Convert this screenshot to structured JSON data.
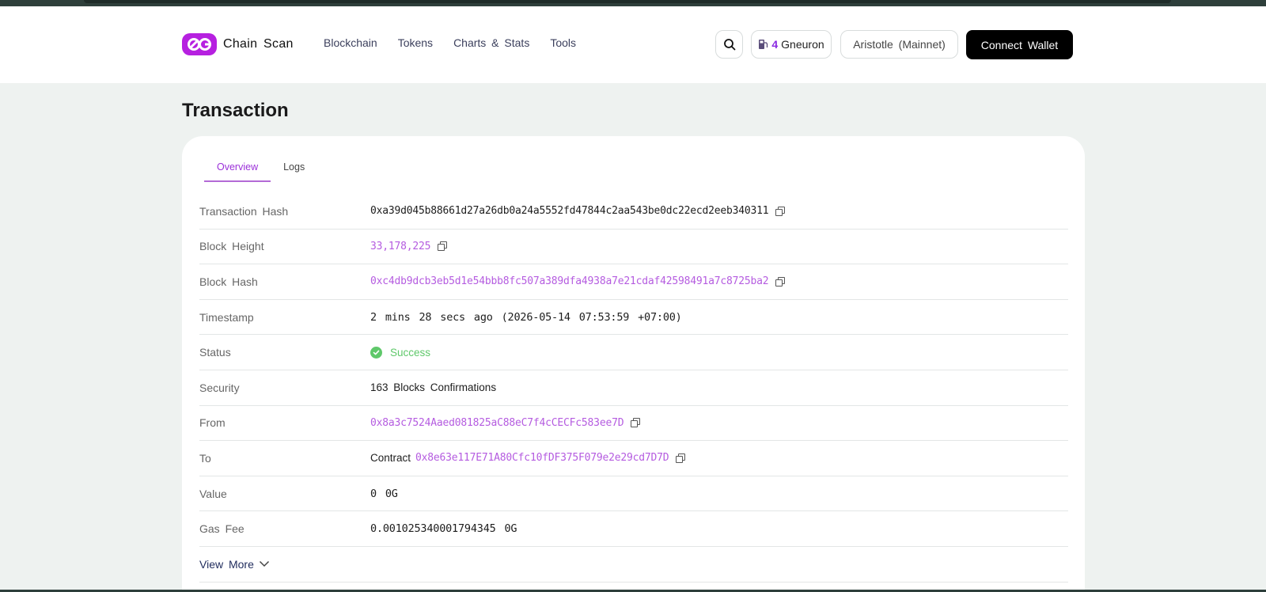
{
  "header": {
    "logo_text": "Chain Scan",
    "nav": [
      "Blockchain",
      "Tokens",
      "Charts & Stats",
      "Tools"
    ],
    "gas_value": "4",
    "gas_unit": "Gneuron",
    "network": "Aristotle (Mainnet)",
    "connect_label": "Connect Wallet",
    "brand_color": "#b620e0"
  },
  "page": {
    "title": "Transaction"
  },
  "tabs": [
    "Overview",
    "Logs"
  ],
  "rows": {
    "tx_hash": {
      "label": "Transaction Hash",
      "value": "0xa39d045b88661d27a26db0a24a5552fd47844c2aa543be0dc22ecd2eeb340311"
    },
    "block_height": {
      "label": "Block Height",
      "value": "33,178,225"
    },
    "block_hash": {
      "label": "Block Hash",
      "value": "0xc4db9dcb3eb5d1e54bbb8fc507a389dfa4938a7e21cdaf42598491a7c8725ba2"
    },
    "timestamp": {
      "label": "Timestamp",
      "value": "2 mins 28 secs ago (2026-05-14 07:53:59 +07:00)"
    },
    "status": {
      "label": "Status",
      "value": "Success"
    },
    "security": {
      "label": "Security",
      "value": "163 Blocks Confirmations"
    },
    "from": {
      "label": "From",
      "value": "0x8a3c7524Aaed081825aC88eC7f4cCECFc583ee7D"
    },
    "to": {
      "label": "To",
      "prefix": "Contract",
      "value": "0x8e63e117E71A80Cfc10fDF375F079e2e29cd7D7D"
    },
    "value": {
      "label": "Value",
      "value": "0 0G"
    },
    "gas_fee": {
      "label": "Gas Fee",
      "value": "0.001025340001794345 0G"
    }
  },
  "view_more": "View More",
  "icons": [
    "search-icon",
    "gas-pump-icon",
    "copy-icon",
    "check-circle-icon",
    "chevron-down-icon"
  ]
}
